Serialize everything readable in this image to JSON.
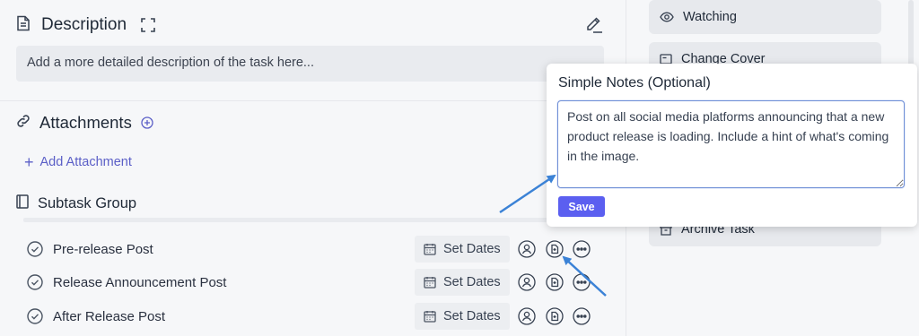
{
  "description": {
    "title": "Description",
    "placeholder": "Add a more detailed description of the task here..."
  },
  "attachments": {
    "title": "Attachments",
    "add_label": "Add Attachment"
  },
  "subtasks": {
    "title": "Subtask Group",
    "set_dates_label": "Set Dates",
    "items": [
      {
        "name": "Pre-release Post"
      },
      {
        "name": "Release Announcement Post"
      },
      {
        "name": "After Release Post"
      }
    ]
  },
  "sidebar": {
    "watching_label": "Watching",
    "change_cover_label": "Change Cover",
    "archive_label": "Archive Task"
  },
  "notes_popup": {
    "title": "Simple Notes (Optional)",
    "value": "Post on all social media platforms announcing that a new product release is loading. Include a hint of what's coming in the image.",
    "save_label": "Save"
  },
  "colors": {
    "accent": "#5b5ff0",
    "link": "#5b5fc7",
    "annotation_arrow": "#3b82d6"
  }
}
